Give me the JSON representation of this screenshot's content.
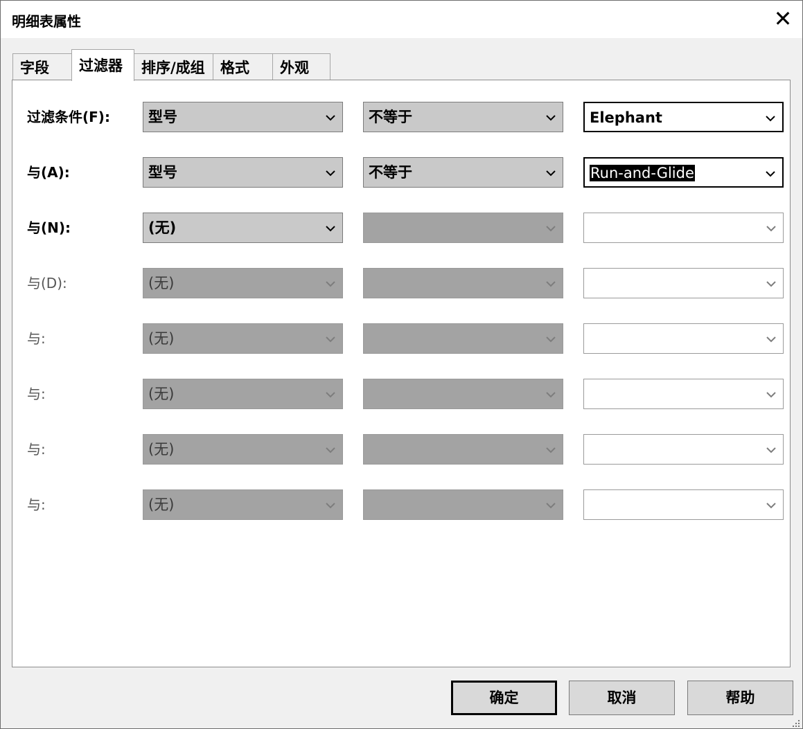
{
  "window": {
    "title": "明细表属性",
    "close_glyph": "✕"
  },
  "tabs": [
    {
      "label": "字段"
    },
    {
      "label": "过滤器",
      "active": true
    },
    {
      "label": "排序/成组"
    },
    {
      "label": "格式"
    },
    {
      "label": "外观"
    }
  ],
  "filters": [
    {
      "label": "过滤条件(F):",
      "field": "型号",
      "operator": "不等于",
      "value": "Elephant",
      "state": "enabled"
    },
    {
      "label": "与(A):",
      "field": "型号",
      "operator": "不等于",
      "value": "Run-and-Glide",
      "value_selected": true,
      "state": "enabled"
    },
    {
      "label": "与(N):",
      "field": "(无)",
      "operator": "",
      "value": "",
      "state": "field-only"
    },
    {
      "label": "与(D):",
      "field": "(无)",
      "operator": "",
      "value": "",
      "state": "disabled"
    },
    {
      "label": "与:",
      "field": "(无)",
      "operator": "",
      "value": "",
      "state": "disabled"
    },
    {
      "label": "与:",
      "field": "(无)",
      "operator": "",
      "value": "",
      "state": "disabled"
    },
    {
      "label": "与:",
      "field": "(无)",
      "operator": "",
      "value": "",
      "state": "disabled"
    },
    {
      "label": "与:",
      "field": "(无)",
      "operator": "",
      "value": "",
      "state": "disabled"
    }
  ],
  "buttons": {
    "ok": "确定",
    "cancel": "取消",
    "help": "帮助"
  },
  "icons": {
    "dropdown": "chevron-down-icon",
    "close": "close-icon",
    "resize": "resize-grip-icon"
  }
}
